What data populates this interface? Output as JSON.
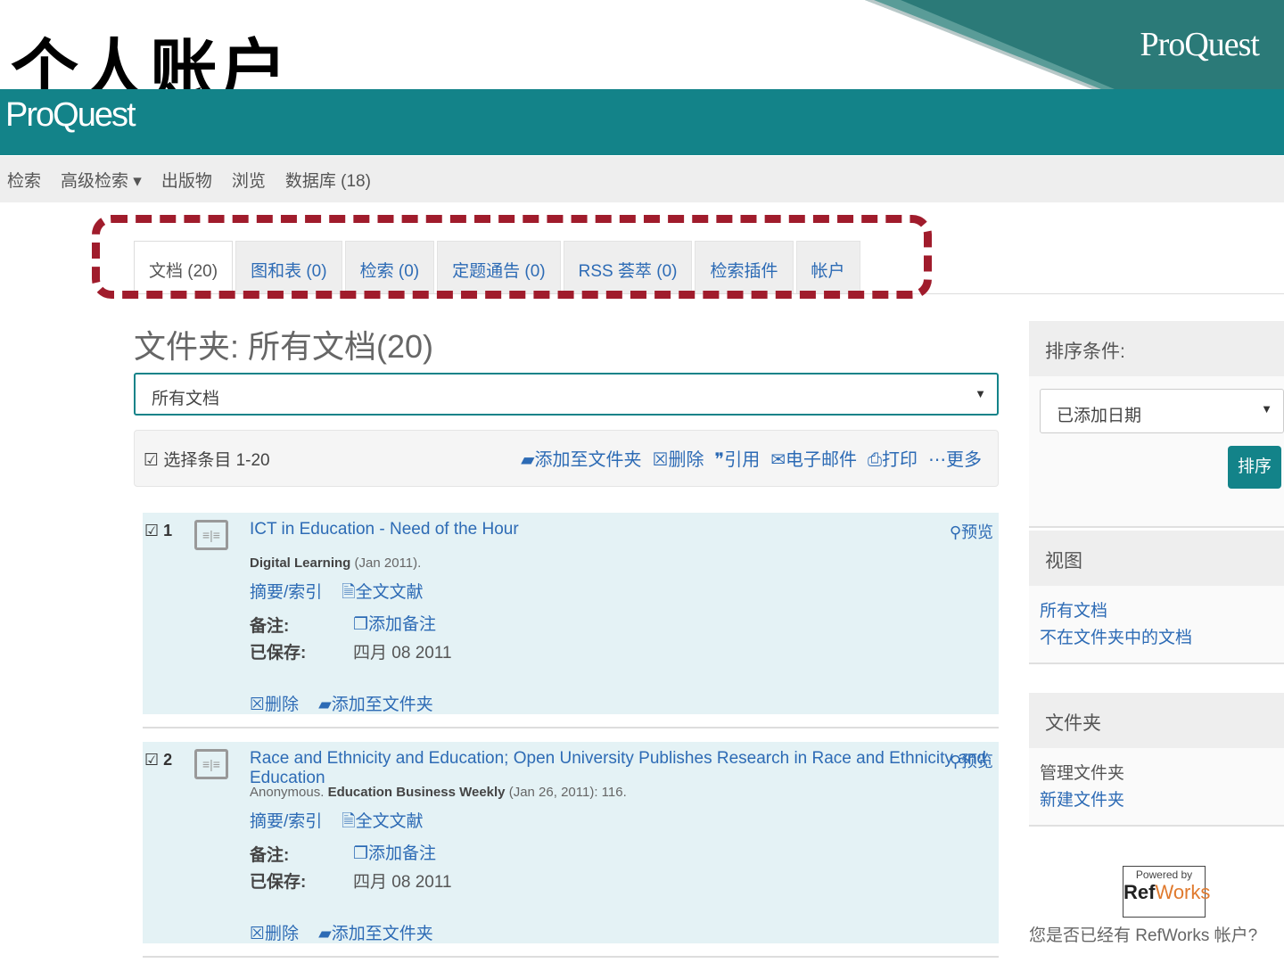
{
  "slide_title": "个人账户",
  "brand": "ProQuest",
  "nav": [
    "检索",
    "高级检索 ▾",
    "出版物",
    "浏览",
    "数据库 (18)"
  ],
  "tabs": [
    "文档 (20)",
    "图和表 (0)",
    "检索 (0)",
    "定题通告 (0)",
    "RSS 荟萃 (0)",
    "检索插件",
    "帐户"
  ],
  "folder_title": "文件夹: 所有文档(20)",
  "folder_select": "所有文档",
  "toolbar": {
    "select_all": "选择条目 1-20",
    "actions": [
      "添加至文件夹",
      "删除",
      "引用",
      "电子邮件",
      "打印",
      "更多"
    ]
  },
  "records": [
    {
      "num": "1",
      "title": "ICT in Education - Need of the Hour",
      "author": "",
      "publication": "Digital Learning",
      "pubinfo": "(Jan 2011).",
      "abstract": "摘要/索引",
      "fulltext": "全文文献",
      "notes_label": "备注:",
      "add_note": "添加备注",
      "saved_label": "已保存:",
      "saved": "四月 08 2011",
      "delete": "删除",
      "add_folder": "添加至文件夹",
      "preview": "预览"
    },
    {
      "num": "2",
      "title": "Race and Ethnicity and Education; Open University Publishes Research in Race and Ethnicity and Education",
      "author": "Anonymous.",
      "publication": "Education Business Weekly",
      "pubinfo": "(Jan 26, 2011): 116.",
      "abstract": "摘要/索引",
      "fulltext": "全文文献",
      "notes_label": "备注:",
      "add_note": "添加备注",
      "saved_label": "已保存:",
      "saved": "四月 08 2011",
      "delete": "删除",
      "add_folder": "添加至文件夹",
      "preview": "预览"
    }
  ],
  "sidebar": {
    "sort_title": "排序条件:",
    "sort_value": "已添加日期",
    "sort_button": "排序",
    "view_title": "视图",
    "view_links": [
      "所有文档",
      "不在文件夹中的文档"
    ],
    "folder_title": "文件夹",
    "folder_links": [
      "管理文件夹",
      "新建文件夹"
    ],
    "refworks_powered": "Powered by",
    "refworks_ref": "Ref",
    "refworks_works": "Works",
    "refworks_question": "您是否已经有 RefWorks 帐户?"
  },
  "colors": {
    "teal": "#138389",
    "link": "#2d6bb5",
    "highlight": "#a01c2c"
  }
}
